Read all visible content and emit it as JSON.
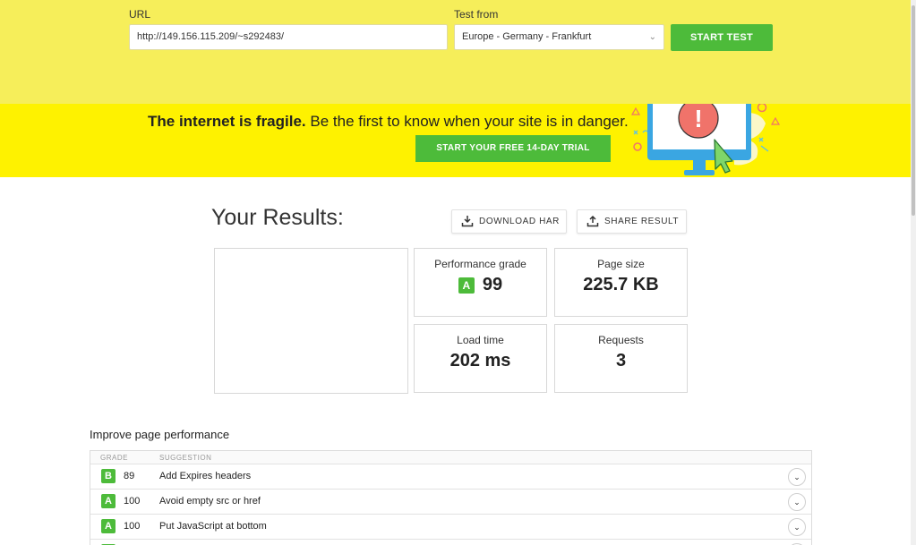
{
  "form": {
    "url_label": "URL",
    "url_value": "http://149.156.115.209/~s292483/",
    "test_from_label": "Test from",
    "test_from_value": "Europe - Germany - Frankfurt",
    "start_label": "START TEST"
  },
  "promo": {
    "headline_bold": "The internet is fragile.",
    "headline_rest": " Be the first to know when your site is in danger.",
    "trial_label": "START YOUR FREE 14-DAY TRIAL",
    "alert_glyph": "!"
  },
  "results": {
    "title": "Your Results:",
    "download_label": "DOWNLOAD HAR",
    "share_label": "SHARE RESULT",
    "performance_label": "Performance grade",
    "performance_grade": "A",
    "performance_score": "99",
    "page_size_label": "Page size",
    "page_size_value": "225.7 KB",
    "load_time_label": "Load time",
    "load_time_value": "202 ms",
    "requests_label": "Requests",
    "requests_value": "3"
  },
  "improve": {
    "title": "Improve page performance",
    "col_grade": "GRADE",
    "col_suggestion": "SUGGESTION",
    "rows": [
      {
        "grade": "B",
        "score": "89",
        "suggestion": "Add Expires headers",
        "color": "#4dbb3a"
      },
      {
        "grade": "A",
        "score": "100",
        "suggestion": "Avoid empty src or href",
        "color": "#4dbb3a"
      },
      {
        "grade": "A",
        "score": "100",
        "suggestion": "Put JavaScript at bottom",
        "color": "#4dbb3a"
      },
      {
        "grade": "A",
        "score": "",
        "suggestion": "",
        "color": "#4dbb3a"
      }
    ]
  },
  "colors": {
    "accent_green": "#4dbb3a",
    "band_yellow": "#f6ee5a",
    "promo_yellow": "#fef200"
  }
}
